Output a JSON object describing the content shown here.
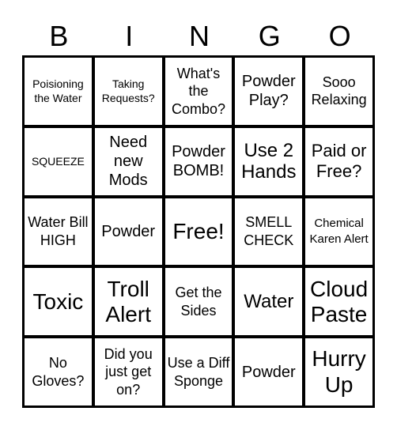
{
  "header": {
    "letters": [
      "B",
      "I",
      "N",
      "G",
      "O"
    ]
  },
  "board": {
    "rows": [
      [
        "Poisioning the Water",
        "Taking Requests?",
        "What's the Combo?",
        "Powder Play?",
        "Sooo Relaxing"
      ],
      [
        "SQUEEZE",
        "Need new Mods",
        "Powder BOMB!",
        "Use 2 Hands",
        "Paid or Free?"
      ],
      [
        "Water Bill HIGH",
        "Powder",
        "Free!",
        "SMELL CHECK",
        "Chemical Karen Alert"
      ],
      [
        "Toxic",
        "Troll Alert",
        "Get the Sides",
        "Water",
        "Cloud Paste"
      ],
      [
        "No Gloves?",
        "Did you just get on?",
        "Use a Diff Sponge",
        "Powder",
        "Hurry Up"
      ]
    ]
  },
  "colors": {
    "background": "#ffffff",
    "grid_lines": "#000000",
    "text": "#000000"
  }
}
